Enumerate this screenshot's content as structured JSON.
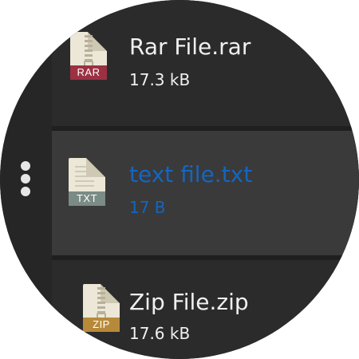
{
  "files": [
    {
      "name": "Rar File.rar",
      "size": "17.3 kB",
      "tag": "RAR",
      "icon": "archive-file-icon",
      "selected": false
    },
    {
      "name": "text file.txt",
      "size": "17 B",
      "tag": "TXT",
      "icon": "text-file-icon",
      "selected": true
    },
    {
      "name": "Zip File.zip",
      "size": "17.6 kB",
      "tag": "ZIP",
      "icon": "archive-file-icon",
      "selected": false
    }
  ],
  "colors": {
    "background": "#1f1f1f",
    "row": "#2b2b2b",
    "selected_row": "#3a3a3a",
    "selected_text": "#1565c0",
    "rar_tag": "#9b3142",
    "txt_tag": "#7b8b86",
    "zip_tag": "#b78a3a"
  },
  "menu": {
    "icon": "more-vertical-icon"
  }
}
